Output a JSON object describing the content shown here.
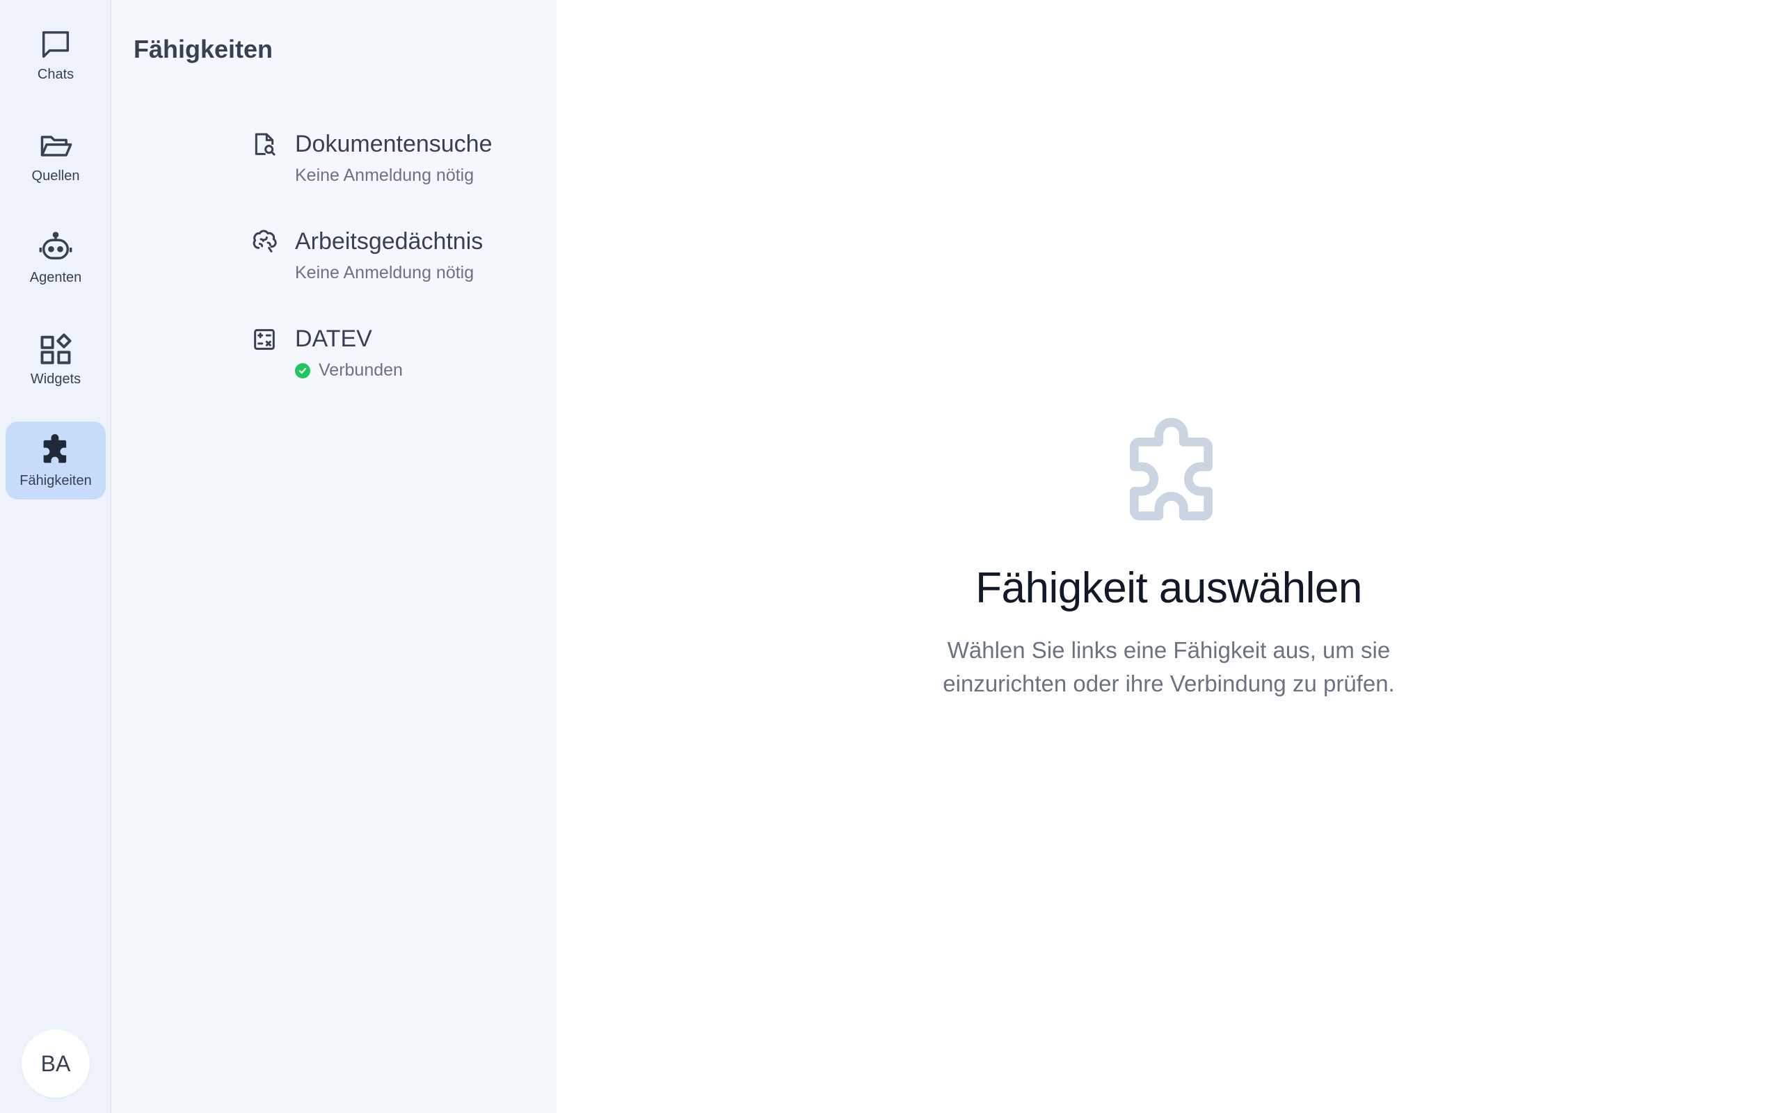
{
  "nav": {
    "items": [
      {
        "label": "Chats",
        "icon": "chat-bubble-icon"
      },
      {
        "label": "Quellen",
        "icon": "folder-open-icon"
      },
      {
        "label": "Agenten",
        "icon": "robot-icon"
      },
      {
        "label": "Widgets",
        "icon": "widgets-icon"
      },
      {
        "label": "Fähigkeiten",
        "icon": "puzzle-icon",
        "active": true
      }
    ],
    "avatar": "BA"
  },
  "panel": {
    "title": "Fähigkeiten",
    "skills": [
      {
        "name": "Dokumentensuche",
        "status": "Keine Anmeldung nötig",
        "icon": "document-search-icon"
      },
      {
        "name": "Arbeitsgedächtnis",
        "status": "Keine Anmeldung nötig",
        "icon": "brain-icon"
      },
      {
        "name": "DATEV",
        "status": "Verbunden",
        "icon": "calculator-icon",
        "connected": true
      }
    ]
  },
  "main": {
    "title": "Fähigkeit auswählen",
    "description": "Wählen Sie links eine Fähigkeit aus, um sie einzurichten oder ihre Verbindung zu prüfen."
  },
  "colors": {
    "active_nav": "#c7dcfb",
    "connected": "#22c55e",
    "puzzle": "#cbd5e1"
  }
}
